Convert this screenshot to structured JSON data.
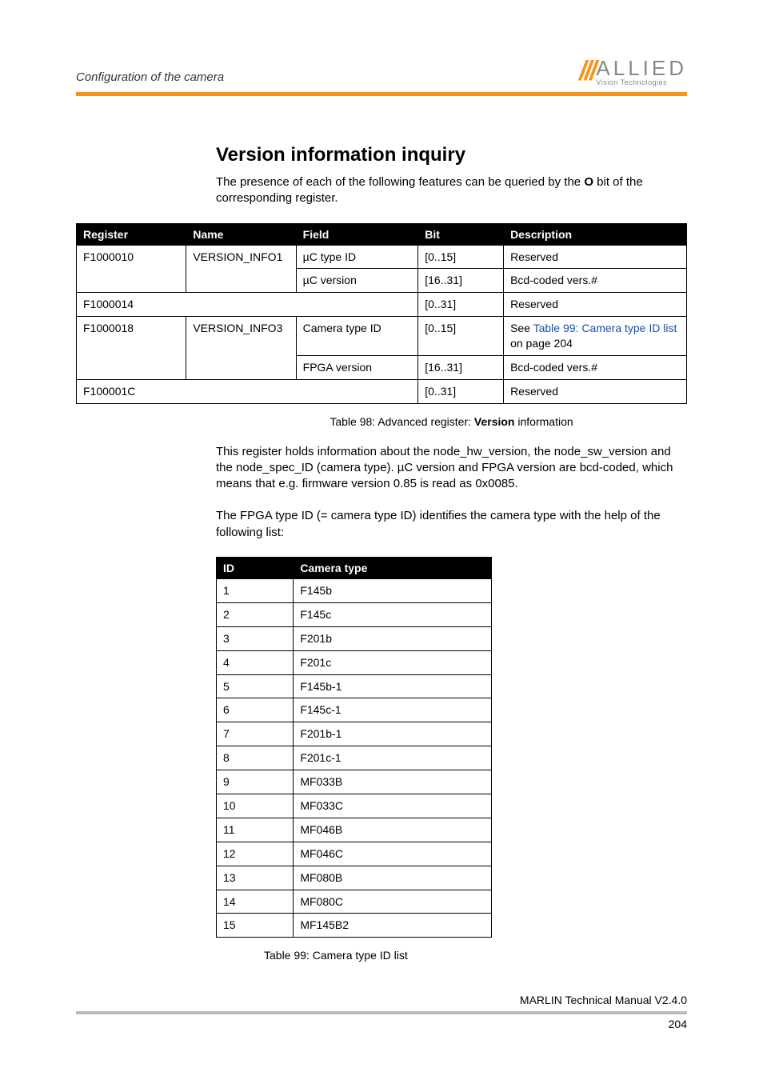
{
  "header": {
    "section": "Configuration of the camera",
    "logo_main": "ALLIED",
    "logo_sub": "Vision Technologies"
  },
  "title": "Version information inquiry",
  "intro_pre": "The presence of each of the following features can be queried by the ",
  "intro_bold": "O",
  "intro_post": " bit of the corresponding register.",
  "table1": {
    "headers": [
      "Register",
      "Name",
      "Field",
      "Bit",
      "Description"
    ],
    "rows": [
      {
        "register": "F1000010",
        "name": "VERSION_INFO1",
        "field": "µC type ID",
        "bit": "[0..15]",
        "desc": "Reserved"
      },
      {
        "register": "",
        "name": "",
        "field": "µC version",
        "bit": "[16..31]",
        "desc": "Bcd-coded vers.#"
      },
      {
        "register": "F1000014",
        "name": "",
        "field": "",
        "bit": "[0..31]",
        "desc": "Reserved",
        "span3": true
      },
      {
        "register": "F1000018",
        "name": "VERSION_INFO3",
        "field": "Camera type ID",
        "bit": "[0..15]",
        "desc_link_pre": "See ",
        "desc_link": "Table 99: Camera type ID list",
        "desc_link_post": " on page 204"
      },
      {
        "register": "",
        "name": "",
        "field": "FPGA version",
        "bit": "[16..31]",
        "desc": "Bcd-coded vers.#"
      },
      {
        "register": "F100001C",
        "name": "",
        "field": "",
        "bit": "[0..31]",
        "desc": "Reserved",
        "span3": true
      }
    ],
    "caption_pre": "Table 98: Advanced register: ",
    "caption_bold": "Version",
    "caption_post": " information"
  },
  "para1": "This register holds information about the node_hw_version, the node_sw_version and the node_spec_ID (camera type). µC version and FPGA version are bcd-coded, which means that e.g. firmware version 0.85 is read as 0x0085.",
  "para2": "The FPGA type ID (= camera type ID) identifies the camera type with the help of the following list:",
  "table2": {
    "headers": [
      "ID",
      "Camera type"
    ],
    "rows": [
      {
        "id": "1",
        "type": "F145b"
      },
      {
        "id": "2",
        "type": "F145c"
      },
      {
        "id": "3",
        "type": "F201b"
      },
      {
        "id": "4",
        "type": "F201c"
      },
      {
        "id": "5",
        "type": "F145b-1"
      },
      {
        "id": "6",
        "type": "F145c-1"
      },
      {
        "id": "7",
        "type": "F201b-1"
      },
      {
        "id": "8",
        "type": "F201c-1"
      },
      {
        "id": "9",
        "type": "MF033B"
      },
      {
        "id": "10",
        "type": "MF033C"
      },
      {
        "id": "11",
        "type": "MF046B"
      },
      {
        "id": "12",
        "type": "MF046C"
      },
      {
        "id": "13",
        "type": "MF080B"
      },
      {
        "id": "14",
        "type": "MF080C"
      },
      {
        "id": "15",
        "type": "MF145B2"
      }
    ],
    "caption": "Table 99: Camera type ID list"
  },
  "footer": {
    "text": "MARLIN Technical Manual V2.4.0",
    "page": "204"
  }
}
